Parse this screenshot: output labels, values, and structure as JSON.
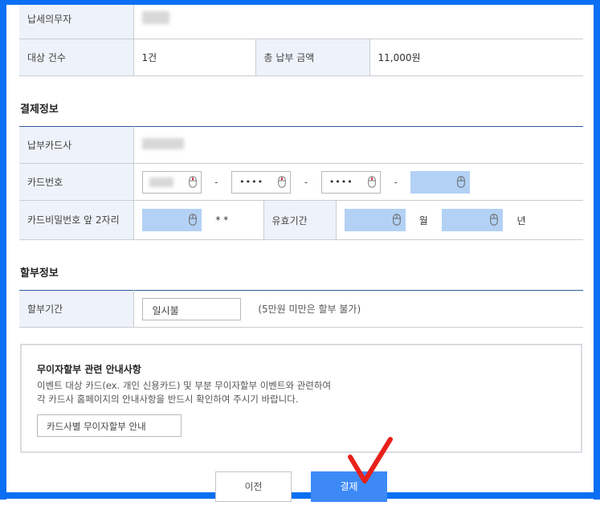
{
  "summary": {
    "taxpayer_label": "납세의무자",
    "count_label": "대상 건수",
    "count_value": "1건",
    "total_label": "총 납부 금액",
    "total_value": "11,000원"
  },
  "payment": {
    "section_title": "결제정보",
    "card_company_label": "납부카드사",
    "card_number_label": "카드번호",
    "card_segments": [
      "",
      "••••",
      "••••",
      ""
    ],
    "separator": "-",
    "password_label": "카드비밀번호 앞 2자리",
    "password_suffix": "* *",
    "expiry_label": "유효기간",
    "month_unit": "월",
    "year_unit": "년"
  },
  "installment": {
    "section_title": "할부정보",
    "period_label": "할부기간",
    "period_value": "일시불",
    "period_note": "(5만원 미만은 할부 불가)"
  },
  "notice": {
    "title": "무이자할부 관련 안내사항",
    "line1": "이벤트 대상 카드(ex. 개인 신용카드) 및 부분 무이자할부 이벤트와 관련하여",
    "line2": "각 카드사 홈페이지의 안내사항을 반드시 확인하여 주시기 바랍니다.",
    "button_label": "카드사별 무이자할부 안내"
  },
  "actions": {
    "prev_label": "이전",
    "pay_label": "결제"
  },
  "colors": {
    "frame": "#0a6ff2",
    "header_cell": "#eef3fb",
    "secure_input": "#b3d1f5",
    "pay_button": "#3d8af7",
    "check_mark": "#e8201a"
  }
}
